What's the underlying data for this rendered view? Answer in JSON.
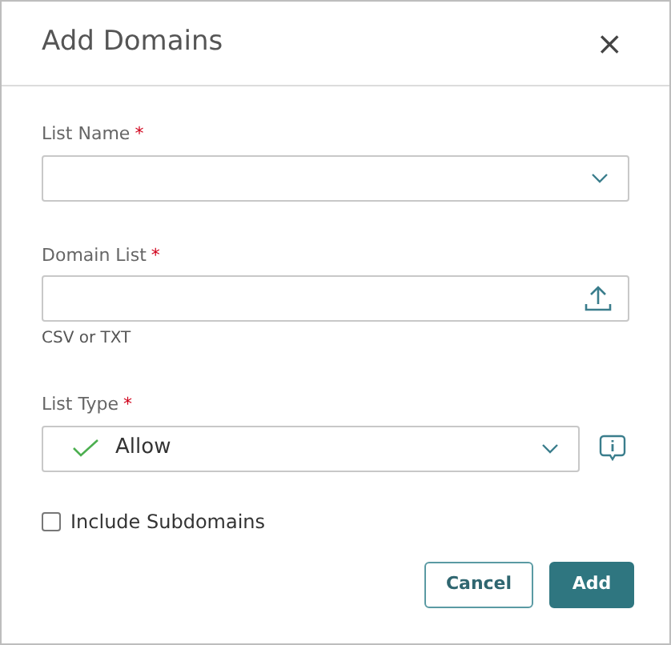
{
  "dialog": {
    "title": "Add Domains",
    "close": "×"
  },
  "fields": [
    {
      "kind": "select",
      "label": "List Name",
      "required": true,
      "required_mark": "*"
    },
    {
      "kind": "upload",
      "label": "Domain List",
      "required": true,
      "required_mark": "*",
      "hint": "CSV or TXT"
    },
    {
      "kind": "select",
      "label": "List Type",
      "required": true,
      "required_mark": "*",
      "value": "Allow",
      "value_checked": true,
      "info": true
    }
  ],
  "checkbox": {
    "label": "Include Subdomains",
    "checked": false
  },
  "buttons": [
    {
      "label": "Cancel",
      "kind": "secondary"
    },
    {
      "label": "Add",
      "kind": "primary"
    }
  ]
}
